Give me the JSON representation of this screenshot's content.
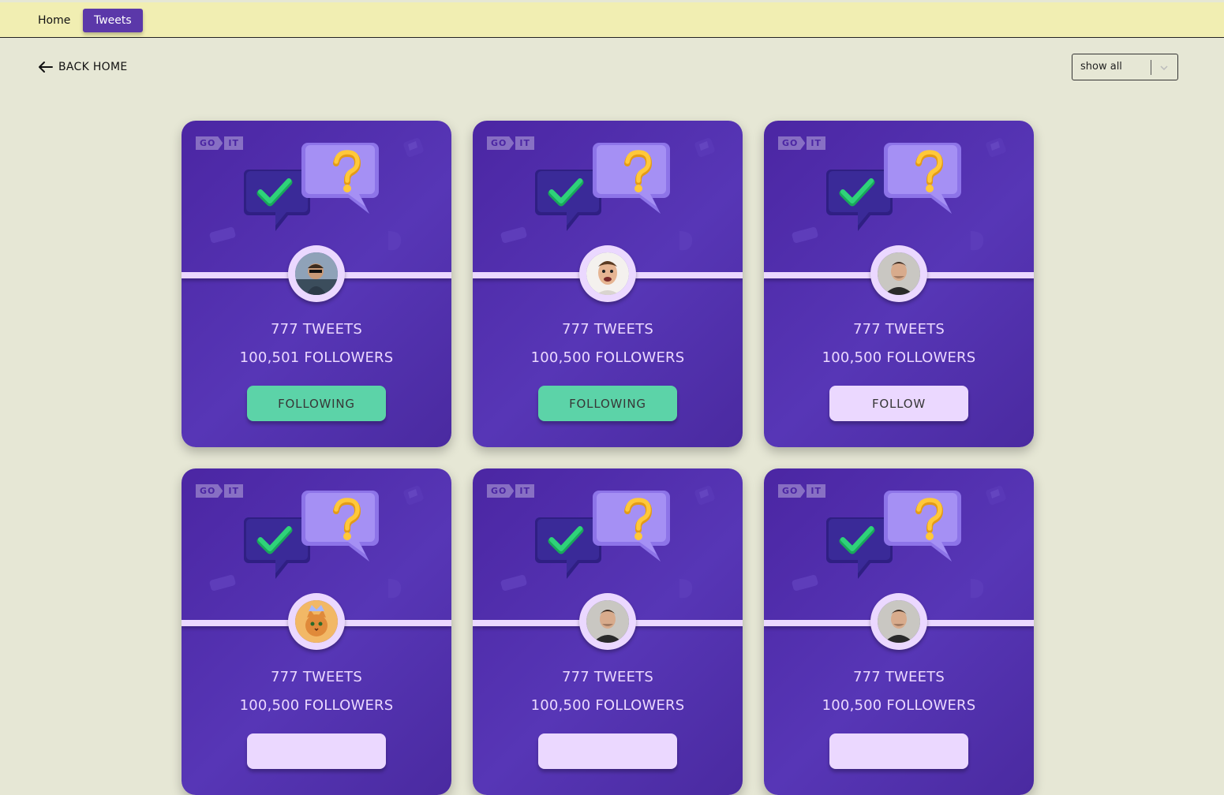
{
  "nav": {
    "home": "Home",
    "tweets": "Tweets",
    "active": "Tweets"
  },
  "back": {
    "label": "BACK HOME",
    "icon": "arrow-left-icon"
  },
  "filter": {
    "value": "show all",
    "icon": "chevron-down-icon"
  },
  "brand": {
    "go": "GO",
    "it": "IT"
  },
  "colors": {
    "card": "#5736b6",
    "following": "#5cd3a8",
    "follow": "#ebd8ff",
    "topbar": "#f1eeb2",
    "page": "#e6e7d5",
    "active_tab": "#5b38a9"
  },
  "cards": [
    {
      "tweets": "777 TWEETS",
      "followers": "100,501 FOLLOWERS",
      "button": "FOLLOWING",
      "state": "following",
      "avatar": "man-with-sunglasses"
    },
    {
      "tweets": "777 TWEETS",
      "followers": "100,500 FOLLOWERS",
      "button": "FOLLOWING",
      "state": "following",
      "avatar": "smiling-man"
    },
    {
      "tweets": "777 TWEETS",
      "followers": "100,500 FOLLOWERS",
      "button": "FOLLOW",
      "state": "follow",
      "avatar": "man-dark-shirt"
    },
    {
      "tweets": "777 TWEETS",
      "followers": "100,500 FOLLOWERS",
      "button": "",
      "state": "follow",
      "avatar": "cat-with-crown"
    },
    {
      "tweets": "777 TWEETS",
      "followers": "100,500 FOLLOWERS",
      "button": "",
      "state": "follow",
      "avatar": "man-dark-shirt"
    },
    {
      "tweets": "777 TWEETS",
      "followers": "100,500 FOLLOWERS",
      "button": "",
      "state": "follow",
      "avatar": "man-dark-shirt"
    }
  ]
}
